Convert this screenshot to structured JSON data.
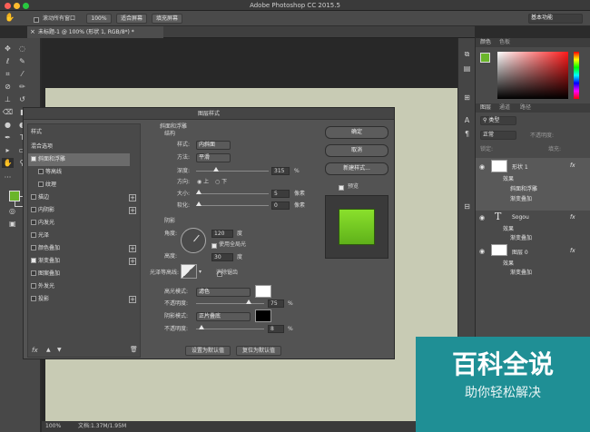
{
  "app": {
    "title": "Adobe Photoshop CC 2015.5"
  },
  "options": {
    "scroll_all": "滚动所有窗口",
    "zoom": "100%",
    "fit_screen": "适合屏幕",
    "fill_screen": "填充屏幕",
    "workspace": "基本功能"
  },
  "document": {
    "tab": "未标题-1 @ 100% (形状 1, RGB/8*) *",
    "status_zoom": "100%",
    "status_doc": "文档:1.37M/1.95M"
  },
  "right_panels": {
    "color_tab": "颜色",
    "swatches_tab": "色板",
    "layers_tab": "图层",
    "channels_tab": "通道",
    "paths_tab": "路径",
    "kind": "类型",
    "normal": "正常",
    "opacity": "不透明度:",
    "lock": "锁定:",
    "fill": "填充:",
    "fx": "fx"
  },
  "layers": [
    {
      "name": "形状 1",
      "effects_label": "效果",
      "effects": [
        "斜面和浮雕",
        "渐变叠加"
      ]
    },
    {
      "name": "Sogou",
      "effects_label": "效果",
      "effects": [
        "渐变叠加"
      ]
    },
    {
      "name": "图层 0",
      "effects_label": "效果",
      "effects": [
        "渐变叠加"
      ]
    }
  ],
  "dialog": {
    "title": "图层样式",
    "styles_header": "样式",
    "blend_options": "混合选项",
    "items": [
      {
        "label": "斜面和浮雕",
        "checked": true,
        "plus": false,
        "sub": false,
        "selected": true
      },
      {
        "label": "等高线",
        "checked": false,
        "plus": false,
        "sub": true
      },
      {
        "label": "纹理",
        "checked": false,
        "plus": false,
        "sub": true
      },
      {
        "label": "描边",
        "checked": false,
        "plus": true,
        "sub": false
      },
      {
        "label": "内阴影",
        "checked": false,
        "plus": true,
        "sub": false
      },
      {
        "label": "内发光",
        "checked": false,
        "plus": false,
        "sub": false
      },
      {
        "label": "光泽",
        "checked": false,
        "plus": false,
        "sub": false
      },
      {
        "label": "颜色叠加",
        "checked": false,
        "plus": true,
        "sub": false
      },
      {
        "label": "渐变叠加",
        "checked": true,
        "plus": true,
        "sub": false
      },
      {
        "label": "图案叠加",
        "checked": false,
        "plus": false,
        "sub": false
      },
      {
        "label": "外发光",
        "checked": false,
        "plus": false,
        "sub": false
      },
      {
        "label": "投影",
        "checked": false,
        "plus": true,
        "sub": false
      }
    ],
    "bevel": {
      "section": "斜面和浮雕",
      "struct": "结构",
      "style_label": "样式:",
      "style_value": "内斜面",
      "method_label": "方法:",
      "method_value": "平滑",
      "depth_label": "深度:",
      "depth_value": "315",
      "pct": "%",
      "direction_label": "方向:",
      "up": "上",
      "down": "下",
      "size_label": "大小:",
      "size_value": "5",
      "px": "像素",
      "soften_label": "软化:",
      "soften_value": "0"
    },
    "shading": {
      "section": "阴影",
      "angle_label": "角度:",
      "angle_value": "120",
      "deg": "度",
      "global_light": "使用全局光",
      "altitude_label": "高度:",
      "altitude_value": "30",
      "gloss_label": "光泽等高线:",
      "antialias": "消除锯齿",
      "highlight_label": "高光模式:",
      "highlight_value": "滤色",
      "hl_opacity_value": "75",
      "shadow_label": "阴影模式:",
      "shadow_value": "正片叠底",
      "sh_opacity_value": "8",
      "opacity_label": "不透明度:",
      "pct": "%",
      "set_default": "设置为默认值",
      "reset_default": "复位为默认值"
    },
    "buttons": {
      "ok": "确定",
      "cancel": "取消",
      "new_style": "新建样式...",
      "preview": "预览"
    },
    "fx": "fx"
  },
  "watermark": {
    "title": "百科全说",
    "subtitle": "助你轻松解决"
  },
  "colors": {
    "accent_green": "#6ab52b",
    "preview_green": "#7ed321",
    "watermark": "#1f8f95"
  }
}
